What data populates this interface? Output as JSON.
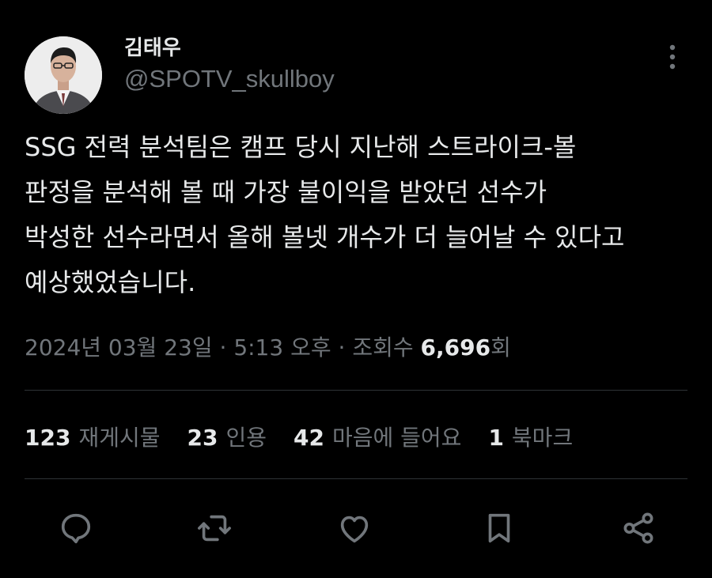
{
  "author": {
    "display_name": "김태우",
    "handle": "@SPOTV_skullboy",
    "avatar_icon": "person-avatar"
  },
  "tweet": {
    "lines": [
      "SSG 전력 분석팀은 캠프 당시 지난해 스트라이크-볼",
      "판정을 분석해 볼 때 가장 불이익을 받았던 선수가",
      "박성한 선수라면서 올해 볼넷 개수가 더 늘어날 수 있다고",
      "예상했었습니다."
    ]
  },
  "meta": {
    "date": "2024년 03월 23일",
    "sep1": " · ",
    "time": "5:13 오후",
    "sep2": " · ",
    "views_label": "조회수 ",
    "views_count": "6,696",
    "views_suffix": "회"
  },
  "stats": [
    {
      "num": "123",
      "label": "재게시물"
    },
    {
      "num": "23",
      "label": "인용"
    },
    {
      "num": "42",
      "label": "마음에 들어요"
    },
    {
      "num": "1",
      "label": "북마크"
    }
  ],
  "actions": [
    "reply-icon",
    "retweet-icon",
    "like-icon",
    "bookmark-icon",
    "share-icon"
  ],
  "colors": {
    "background": "#000000",
    "text": "#e7e9ea",
    "muted": "#71767b",
    "divider": "#2f3336"
  }
}
